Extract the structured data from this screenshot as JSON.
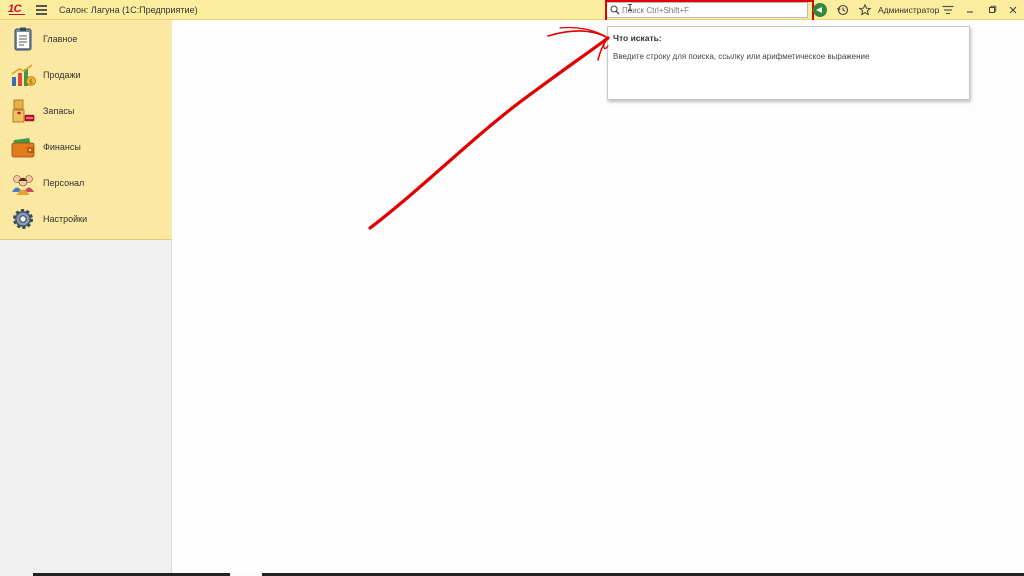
{
  "app": {
    "logo": "1С",
    "title": "Салон: Лагуна  (1С:Предприятие)"
  },
  "toolbar": {
    "search_placeholder": "Поиск Ctrl+Shift+F",
    "user": "Администратор"
  },
  "sidebar": {
    "items": [
      {
        "label": "Главное",
        "icon": "main-icon"
      },
      {
        "label": "Продажи",
        "icon": "sales-icon"
      },
      {
        "label": "Запасы",
        "icon": "stock-icon"
      },
      {
        "label": "Финансы",
        "icon": "finance-icon"
      },
      {
        "label": "Персонал",
        "icon": "staff-icon"
      },
      {
        "label": "Настройки",
        "icon": "gear-icon"
      }
    ]
  },
  "search_popup": {
    "title": "Что искать:",
    "hint": "Введите строку для поиска, ссылку или арифметическое выражение"
  },
  "colors": {
    "header_bg": "#fbed9e",
    "sidebar_bg": "#fbe8a2",
    "annotation_red": "#e00000",
    "logo_red": "#c8102e"
  }
}
